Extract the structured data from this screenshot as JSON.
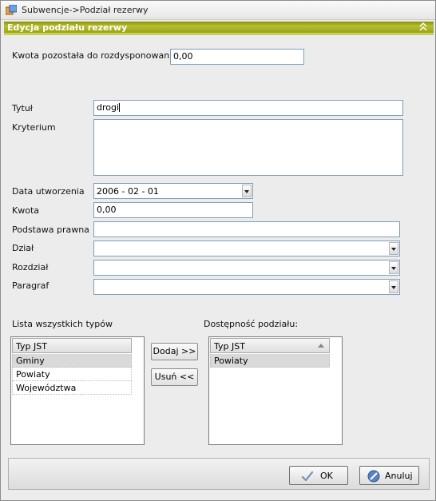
{
  "window": {
    "title": "Subwencje->Podział rezerwy"
  },
  "panel": {
    "title": "Edycja podziału rezerwy",
    "collapse_glyph": "⌃"
  },
  "form": {
    "remaining_label": "Kwota pozostała do rozdysponowania:",
    "remaining_value": "0,00",
    "title_label": "Tytuł",
    "title_value": "drogi",
    "criterion_label": "Kryterium",
    "criterion_value": "",
    "date_label": "Data utworzenia",
    "date_value": "2006 - 02 - 01",
    "amount_label": "Kwota",
    "amount_value": "0,00",
    "legal_basis_label": "Podstawa prawna",
    "legal_basis_value": "",
    "department_label": "Dział",
    "department_value": "",
    "chapter_label": "Rozdział",
    "chapter_value": "",
    "paragraph_label": "Paragraf",
    "paragraph_value": ""
  },
  "lists": {
    "all_types_label": "Lista wszystkich typów",
    "available_label": "Dostępność podziału:",
    "column_header": "Typ JST",
    "all_types": [
      "Gminy",
      "Powiaty",
      "Województwa"
    ],
    "available": [
      "Powiaty"
    ],
    "add_button": "Dodaj >>",
    "remove_button": "Usuń <<"
  },
  "footer": {
    "ok_label": "OK",
    "cancel_label": "Anuluj"
  }
}
